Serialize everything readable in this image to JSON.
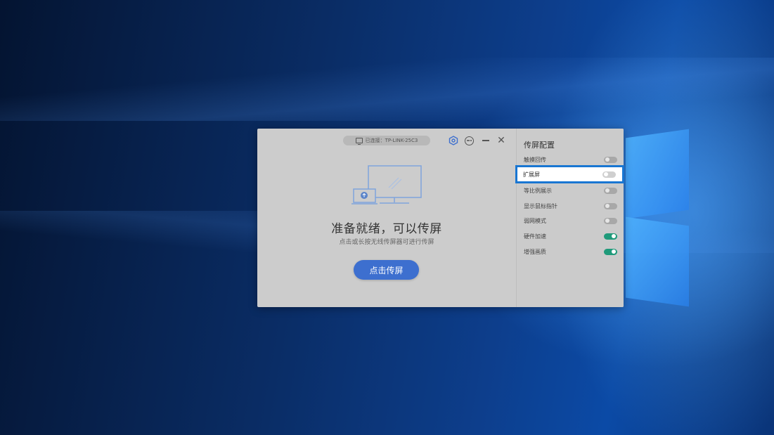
{
  "connection": {
    "status_label": "已连接：TP-LINK-25C3"
  },
  "main": {
    "title": "准备就绪，可以传屏",
    "subtitle": "点击或长按无线传屏器可进行传屏",
    "cast_button_label": "点击传屏"
  },
  "titlebar": {
    "icons": [
      "settings-hex-icon",
      "more-icon",
      "minimize-icon",
      "close-icon"
    ],
    "close_glyph": "✕"
  },
  "sidebar": {
    "title": "传屏配置",
    "options": [
      {
        "label": "触摸回传",
        "on": false
      },
      {
        "label": "扩展屏",
        "on": false,
        "highlighted": true
      },
      {
        "label": "等比例展示",
        "on": false
      },
      {
        "label": "显示鼠标指针",
        "on": false
      },
      {
        "label": "弱网模式",
        "on": false
      },
      {
        "label": "硬件加速",
        "on": true
      },
      {
        "label": "增强画质",
        "on": true
      }
    ]
  },
  "colors": {
    "accent_blue": "#3d6fcf",
    "toggle_on": "#1f9a7a",
    "highlight_border": "#1976d2"
  }
}
